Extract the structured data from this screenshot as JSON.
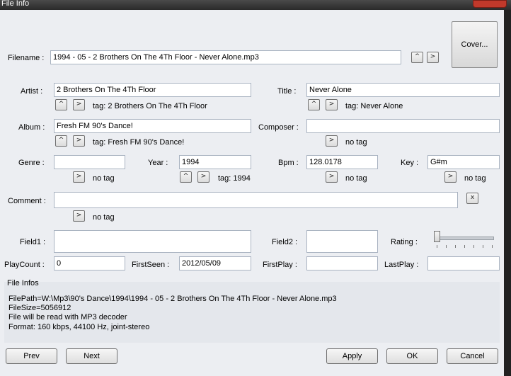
{
  "window": {
    "title": "File Info"
  },
  "filename": {
    "label": "Filename :",
    "value": "1994 - 05 - 2 Brothers On The 4Th Floor - Never Alone.mp3"
  },
  "cover_button": "Cover...",
  "artist": {
    "label": "Artist :",
    "value": "2 Brothers On The 4Th Floor",
    "tag": "tag: 2 Brothers On The 4Th Floor"
  },
  "title": {
    "label": "Title :",
    "value": "Never Alone",
    "tag": "tag: Never Alone"
  },
  "album": {
    "label": "Album :",
    "value": "Fresh FM 90's Dance!",
    "tag": "tag: Fresh FM 90's Dance!"
  },
  "composer": {
    "label": "Composer :",
    "value": "",
    "tag": "no tag"
  },
  "genre": {
    "label": "Genre :",
    "value": "",
    "tag": "no tag"
  },
  "year": {
    "label": "Year :",
    "value": "1994",
    "tag": "tag: 1994"
  },
  "bpm": {
    "label": "Bpm :",
    "value": "128.0178",
    "tag": "no tag"
  },
  "key": {
    "label": "Key :",
    "value": "G#m",
    "tag": "no tag"
  },
  "comment": {
    "label": "Comment :",
    "value": "",
    "tag": "no tag",
    "clear_label": "x"
  },
  "field1": {
    "label": "Field1 :",
    "value": ""
  },
  "field2": {
    "label": "Field2 :",
    "value": ""
  },
  "rating": {
    "label": "Rating :",
    "value": 0
  },
  "playcount": {
    "label": "PlayCount :",
    "value": "0"
  },
  "firstseen": {
    "label": "FirstSeen :",
    "value": "2012/05/09"
  },
  "firstplay": {
    "label": "FirstPlay :",
    "value": ""
  },
  "lastplay": {
    "label": "LastPlay :",
    "value": ""
  },
  "file_infos": {
    "label": "File Infos",
    "lines": [
      "FilePath=W:\\Mp3\\90's Dance\\1994\\1994 - 05 - 2 Brothers On The 4Th Floor - Never Alone.mp3",
      "FileSize=5056912",
      "File will be read with MP3 decoder",
      "Format: 160 kbps, 44100 Hz, joint-stereo"
    ]
  },
  "buttons": {
    "prev": "Prev",
    "next": "Next",
    "apply": "Apply",
    "ok": "OK",
    "cancel": "Cancel"
  },
  "icons": {
    "up": "^",
    "copy": ">"
  }
}
